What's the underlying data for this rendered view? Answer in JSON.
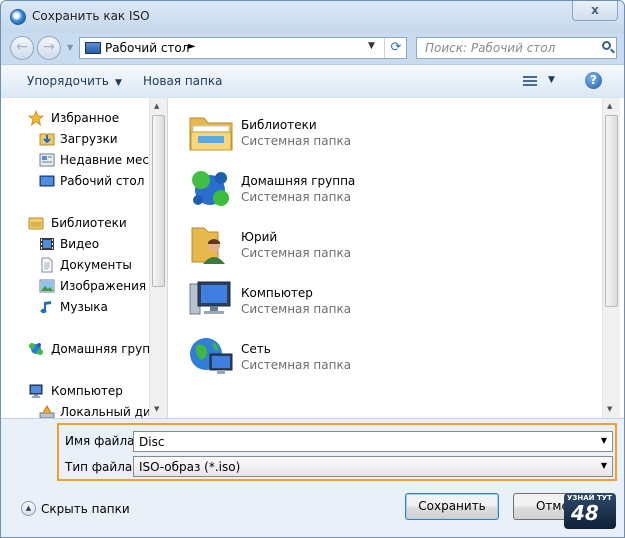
{
  "window": {
    "title": "Сохранить как ISO",
    "close_glyph": "x"
  },
  "nav": {
    "back_glyph": "←",
    "forward_glyph": "→",
    "address": "Рабочий стол",
    "address_chevron": "►",
    "search_placeholder": "Поиск: Рабочий стол"
  },
  "toolbar": {
    "organize": "Упорядочить",
    "new_folder": "Новая папка",
    "help_glyph": "?"
  },
  "sidebar": {
    "items": [
      {
        "label": "Избранное",
        "icon": "star-icon"
      },
      {
        "label": "Загрузки",
        "icon": "downloads-icon"
      },
      {
        "label": "Недавние места",
        "icon": "recent-places-icon"
      },
      {
        "label": "Рабочий стол",
        "icon": "desktop-icon"
      },
      {
        "label": "Библиотеки",
        "icon": "libraries-icon"
      },
      {
        "label": "Видео",
        "icon": "video-icon"
      },
      {
        "label": "Документы",
        "icon": "documents-icon"
      },
      {
        "label": "Изображения",
        "icon": "pictures-icon"
      },
      {
        "label": "Музыка",
        "icon": "music-icon"
      },
      {
        "label": "Домашняя группа",
        "icon": "homegroup-icon"
      },
      {
        "label": "Компьютер",
        "icon": "computer-icon"
      },
      {
        "label": "Локальный диск",
        "icon": "local-disk-icon"
      }
    ]
  },
  "files": [
    {
      "name": "Библиотеки",
      "type": "Системная папка",
      "icon": "libraries-icon"
    },
    {
      "name": "Домашняя группа",
      "type": "Системная папка",
      "icon": "homegroup-icon"
    },
    {
      "name": "Юрий",
      "type": "Системная папка",
      "icon": "user-folder-icon"
    },
    {
      "name": "Компьютер",
      "type": "Системная папка",
      "icon": "computer-icon"
    },
    {
      "name": "Сеть",
      "type": "Системная папка",
      "icon": "network-icon"
    }
  ],
  "form": {
    "filename_label": "Имя файла:",
    "filename_value": "Disc",
    "filetype_label": "Тип файла:",
    "filetype_value": "ISO-образ (*.iso)"
  },
  "footer": {
    "hide_folders": "Скрыть папки",
    "save": "Сохранить",
    "cancel": "Отмена"
  },
  "watermark": {
    "top": "УЗНАЙ ТУТ",
    "number": "48"
  },
  "colors": {
    "highlight_border": "#f0a030",
    "accent": "#1e395b"
  }
}
